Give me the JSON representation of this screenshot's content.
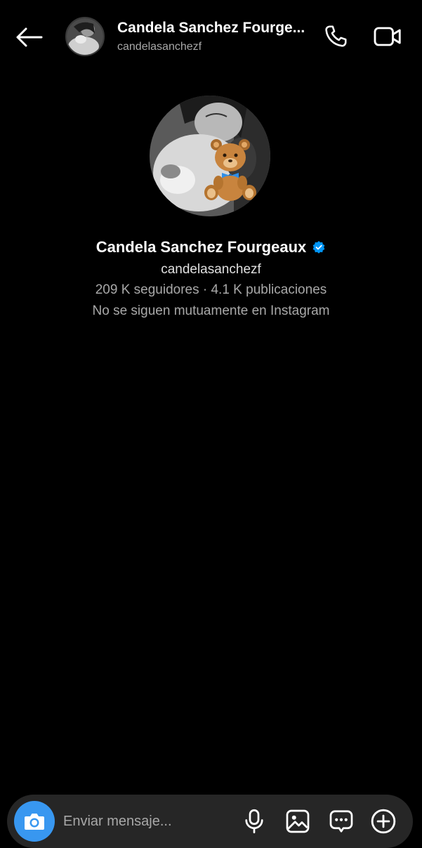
{
  "header": {
    "name": "Candela Sanchez Fourge...",
    "username": "candelasanchezf",
    "icons": {
      "back": "arrow-left-icon",
      "call": "phone-icon",
      "video": "video-camera-icon"
    }
  },
  "profile": {
    "name": "Candela Sanchez Fourgeaux",
    "verified_icon": "verified-badge-icon",
    "username": "candelasanchezf",
    "stats": "209 K seguidores · 4.1 K publicaciones",
    "mutual": "No se siguen mutuamente en Instagram"
  },
  "composer": {
    "placeholder": "Enviar mensaje...",
    "icons": {
      "camera": "camera-icon",
      "mic": "microphone-icon",
      "gallery": "image-icon",
      "sticker": "chat-bubble-icon",
      "plus": "plus-circle-icon"
    }
  },
  "colors": {
    "background": "#000000",
    "accent": "#3897f0",
    "verified": "#0095f6",
    "secondary_text": "#a8a8a8",
    "composer_bg": "#262626"
  }
}
